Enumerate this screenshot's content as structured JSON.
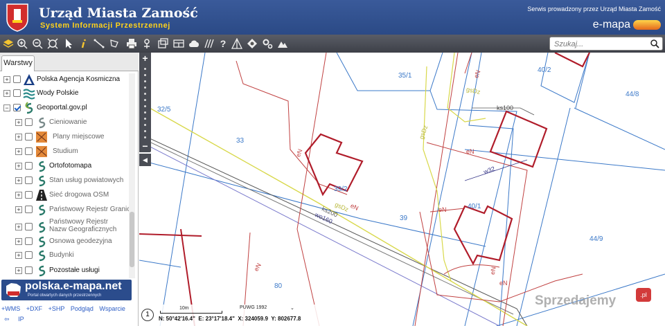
{
  "header": {
    "title": "Urząd Miasta Zamość",
    "subtitle": "System Informacji Przestrzennej",
    "operator": "Serwis prowadzony przez Urząd Miasta Zamość",
    "brand": "e-mapa"
  },
  "search": {
    "placeholder": "Szukaj..."
  },
  "toolbar": {
    "icons": [
      "layers-icon",
      "zoom-in-icon",
      "zoom-out-icon",
      "full-extent-icon",
      "select-pointer-icon",
      "info-icon",
      "measure-line-icon",
      "measure-area-icon",
      "print-icon",
      "pin-icon",
      "export-icon",
      "layout-icon",
      "cloud-icon",
      "hatch-icon",
      "help-icon",
      "profile-icon",
      "tools-icon",
      "settings-icon",
      "terrain-icon"
    ]
  },
  "panel": {
    "tab_label": "Warstwy",
    "layers": [
      {
        "label": "Polska Agencja Kosmiczna",
        "checked": false,
        "indent": 0,
        "grey": false
      },
      {
        "label": "Wody Polskie",
        "checked": false,
        "indent": 0,
        "grey": false
      },
      {
        "label": "Geoportal.gov.pl",
        "checked": true,
        "indent": 0,
        "grey": false,
        "expanded": true
      },
      {
        "label": "Cieniowanie",
        "checked": false,
        "indent": 1,
        "grey": true
      },
      {
        "label": "Plany miejscowe",
        "checked": false,
        "indent": 1,
        "grey": true
      },
      {
        "label": "Studium",
        "checked": false,
        "indent": 1,
        "grey": true
      },
      {
        "label": "Ortofotomapa",
        "checked": false,
        "indent": 1,
        "grey": false
      },
      {
        "label": "Stan usług powiatowych",
        "checked": false,
        "indent": 1,
        "grey": true
      },
      {
        "label": "Sieć drogowa OSM",
        "checked": false,
        "indent": 1,
        "grey": true
      },
      {
        "label": "Państwowy Rejestr Granic",
        "checked": false,
        "indent": 1,
        "grey": true
      },
      {
        "label": "Państwowy Rejestr Nazw Geograficznych",
        "checked": false,
        "indent": 1,
        "grey": true
      },
      {
        "label": "Osnowa geodezyjna",
        "checked": false,
        "indent": 1,
        "grey": true
      },
      {
        "label": "Budynki",
        "checked": false,
        "indent": 1,
        "grey": true
      },
      {
        "label": "Pozostałe usługi",
        "checked": false,
        "indent": 1,
        "grey": false
      }
    ],
    "promo_title": "polska.e-mapa.net",
    "promo_subtitle": "Portal otwartych danych przestrzennych",
    "links": [
      "+WMS",
      "+DXF",
      "+SHP",
      "Podgląd",
      "Wsparcie"
    ],
    "ip_label": "IP"
  },
  "map": {
    "plots": [
      "35/1",
      "40/2",
      "44/8",
      "32/5",
      "33",
      "39/2",
      "39",
      "40/1",
      "44/9",
      "80"
    ],
    "utility_labels": [
      "eN",
      "gsDz",
      "ks100",
      "eN",
      "eN",
      "w32",
      "ks200",
      "gsDz",
      "eN",
      "wo160",
      "eN",
      "eN",
      "gsDz",
      "eN",
      "eN"
    ]
  },
  "status": {
    "info_label": "1",
    "scale_label": "10m",
    "crs": "PUWG 1992",
    "coords": {
      "n": "N: 50°42'16.4\"",
      "e": "E: 23°17'18.4\"",
      "x": "X: 324059.9",
      "y": "Y: 802677.8"
    }
  },
  "watermark": {
    "text": "Sprzedajemy",
    "badge": ".pl"
  },
  "colors": {
    "header": "#2b4a86",
    "subtitle": "#ffd21a",
    "parcel": "#3a78c8",
    "building": "#b01c2a",
    "gas": "#d8d84a"
  }
}
